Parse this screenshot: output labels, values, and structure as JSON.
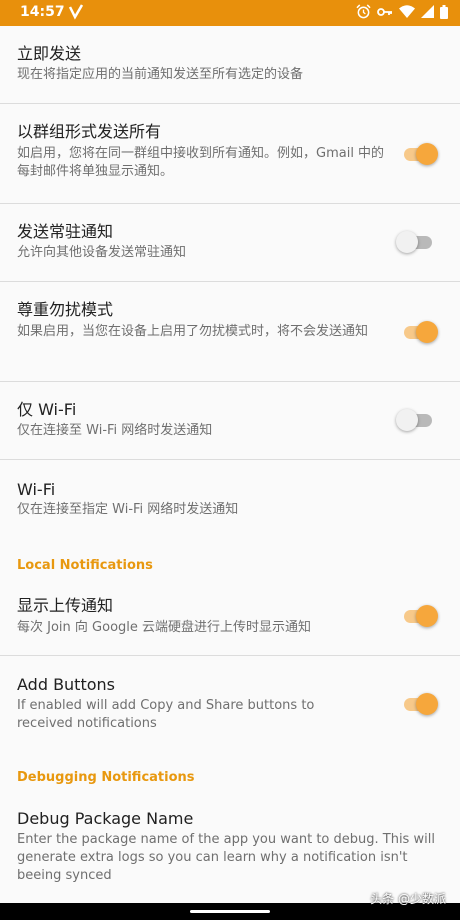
{
  "status_bar": {
    "time": "14:57",
    "background": "#e8900c",
    "icons": [
      "notification-app-icon",
      "alarm-icon",
      "vpn-key-icon",
      "wifi-icon",
      "signal-icon",
      "battery-icon"
    ]
  },
  "accent_color": "#f6a73c",
  "settings": [
    {
      "title": "立即发送",
      "summary": "现在将指定应用的当前通知发送至所有选定的设备"
    },
    {
      "title": "以群组形式发送所有",
      "summary": "如启用，您将在同一群组中接收到所有通知。例如，Gmail 中的每封邮件将单独显示通知。",
      "switch": "on"
    },
    {
      "title": "发送常驻通知",
      "summary": "允许向其他设备发送常驻通知",
      "switch": "off"
    },
    {
      "title": "尊重勿扰模式",
      "summary": "如果启用，当您在设备上启用了勿扰模式时，将不会发送通知",
      "switch": "on"
    },
    {
      "title": "仅 Wi-Fi",
      "summary": "仅在连接至 Wi-Fi 网络时发送通知",
      "switch": "off"
    },
    {
      "title": "Wi-Fi",
      "summary": "仅在连接至指定 Wi-Fi 网络时发送通知"
    }
  ],
  "local_category": {
    "label": "Local Notifications",
    "items": [
      {
        "title": "显示上传通知",
        "summary": "每次 Join 向 Google 云端硬盘进行上传时显示通知",
        "switch": "on"
      },
      {
        "title": "Add Buttons",
        "summary": "If enabled will add Copy and Share buttons to received notifications",
        "switch": "on"
      }
    ]
  },
  "debug_category": {
    "label": "Debugging Notifications",
    "items": [
      {
        "title": "Debug Package Name",
        "summary": "Enter the package name of the app you want to debug. This will generate extra logs so you can learn why a notification isn't beeing synced"
      }
    ]
  },
  "watermark": "头条 @少数派"
}
